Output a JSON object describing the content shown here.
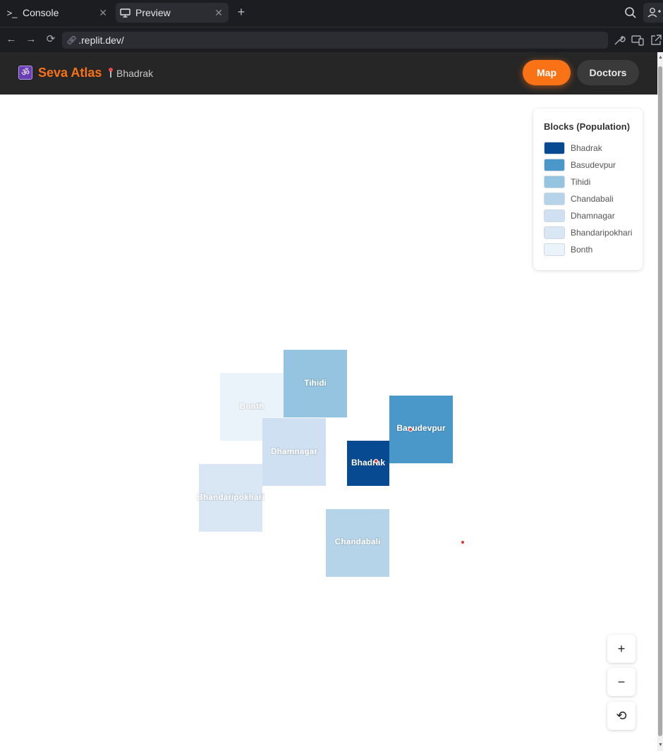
{
  "browser": {
    "tabs": [
      {
        "label": "Console",
        "icon": "terminal-icon"
      },
      {
        "label": "Preview",
        "icon": "monitor-icon"
      }
    ],
    "url": ".replit.dev/"
  },
  "app": {
    "logo_glyph": "ॐ",
    "brand": "Seva Atlas",
    "location": "Bhadrak",
    "nav": {
      "map": "Map",
      "doctors": "Doctors"
    }
  },
  "legend": {
    "title": "Blocks (Population)",
    "items": [
      {
        "label": "Bhadrak",
        "color": "#084a92"
      },
      {
        "label": "Basudevpur",
        "color": "#4a97c9"
      },
      {
        "label": "Tihidi",
        "color": "#94c4df"
      },
      {
        "label": "Chandabali",
        "color": "#b5d4e9"
      },
      {
        "label": "Dhamnagar",
        "color": "#cfe0f2"
      },
      {
        "label": "Bhandaripokhari",
        "color": "#d9e7f5"
      },
      {
        "label": "Bonth",
        "color": "#eaf2fa"
      }
    ]
  },
  "map_labels": {
    "bonth": "Bonth",
    "tihidi": "Tihidi",
    "dhamnagar": "Dhamnagar",
    "bhandaripokhari": "Bhandaripokhari",
    "bhadrak": "Bhadrak",
    "basudevpur": "Basudevpur",
    "chandabali": "Chandabali"
  },
  "map_colors": {
    "marker": "#e23b3b"
  },
  "zoom": {
    "in": "+",
    "out": "−",
    "reset": "⟲"
  }
}
